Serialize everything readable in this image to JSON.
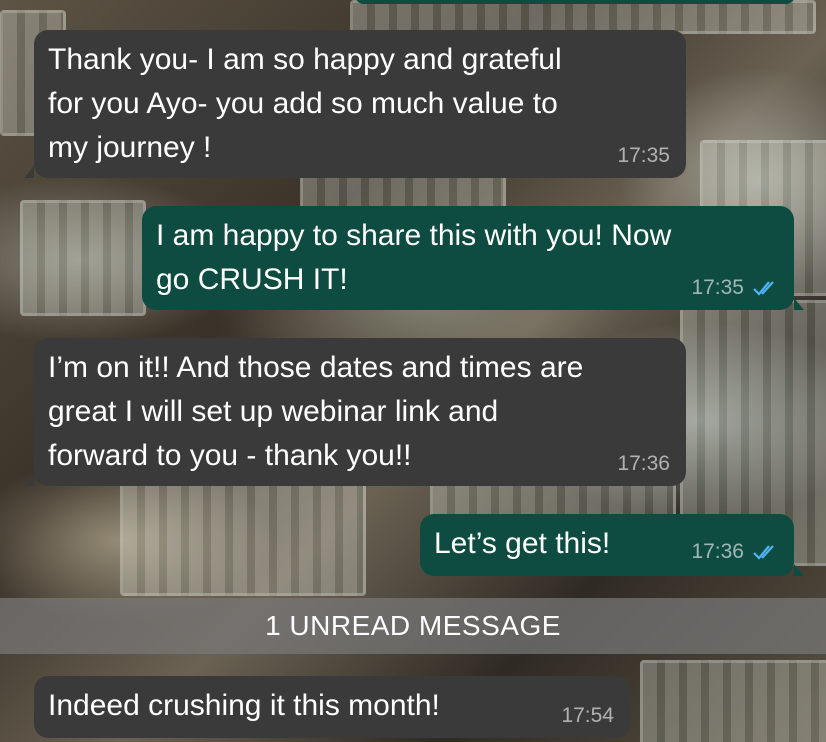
{
  "colors": {
    "incoming_bubble": "#3a3a3a",
    "outgoing_bubble": "#0e4c41",
    "read_ticks": "#4fb3f6",
    "unread_bar": "#787878"
  },
  "messages": [
    {
      "direction": "incoming",
      "text": "Thank you- I am so happy and grateful\nfor you Ayo- you add so much value to\nmy journey !",
      "time": "17:35"
    },
    {
      "direction": "outgoing",
      "text": "I am happy to share this with you! Now\ngo CRUSH IT!",
      "time": "17:35",
      "status_icon": "double-check-icon"
    },
    {
      "direction": "incoming",
      "text": "I’m on it!! And those dates and times are\ngreat I will set up webinar link and\nforward to you - thank you!!",
      "time": "17:36"
    },
    {
      "direction": "outgoing",
      "text": "Let’s get this!",
      "time": "17:36",
      "status_icon": "double-check-icon"
    },
    {
      "direction": "incoming",
      "text": "Indeed crushing it this month!",
      "time": "17:54"
    }
  ],
  "unread_divider": {
    "label": "1 UNREAD MESSAGE"
  }
}
